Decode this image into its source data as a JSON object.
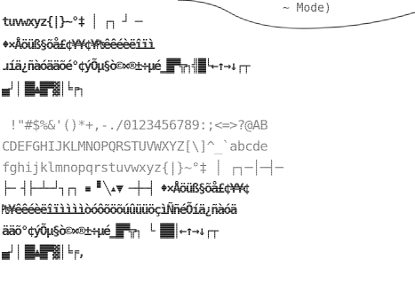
{
  "screen": {
    "mode_label": "~ Mode)",
    "lines": [
      "tuvwxyz{|}~°‡ │ ┌┐ ┘ ─",
      "♦×Åöüß§õå£¢¥¥¢¥₧êêéèëîïì",
      "ɹíä¿ñàóääõé°¢ýÕµ§ò©×®±÷µé▁█▀╦┐╣█└←↑→↓┌┬",
      "▄┘│▐█▲█▀▓│╘╒┐",
      " !\"#$%&'()*+,-./0123456789:;<=>?@AB",
      "CDEFGHIJKLMNOPQRSTUVWXYZ[\\]^_`abcde",
      "fghijklmnopqrstuvwxyz{|}~°‡ │ ┌┐─│─┤─",
      "├─ ┤├─┴─┘┐┌┐ ▪ ▘╲▴▼ ─┼─┤ ♦×Åöüß§õå£¢¥¥¢",
      "₧¥êêéèëîïììììòóôõöõúûüüöçìÑñéÕíä¿ñàóä",
      "ääõ°¢ýÕµ§ò©×®±÷µé▁█▀╦┐ └ ██│←↑→↓┌┬",
      "▄┘│▐█▲█▀▓│╘╒,"
    ]
  }
}
